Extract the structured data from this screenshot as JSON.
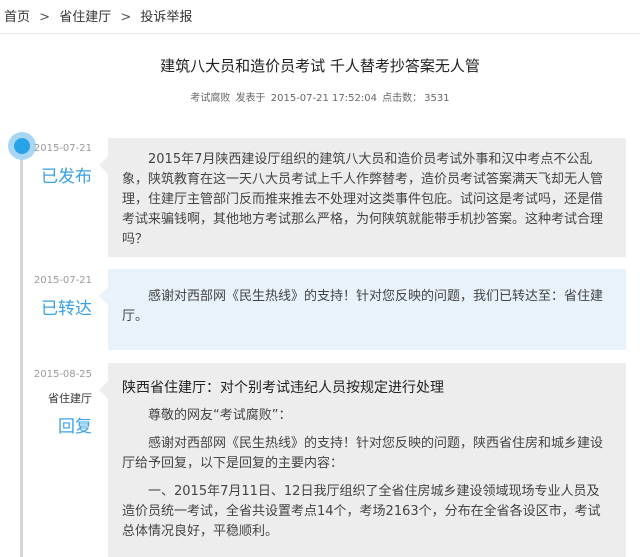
{
  "breadcrumb": {
    "home": "首页",
    "sep1": ">",
    "level2": "省住建厅",
    "sep2": ">",
    "level3": "投诉举报"
  },
  "article": {
    "title": "建筑八大员和造价员考试 千人替考抄答案无人管",
    "author": "考试腐败",
    "posted_label": "发表于",
    "posted_time": "2015-07-21 17:52:04",
    "clicks_label": "点击数：",
    "clicks": "3531"
  },
  "timeline": [
    {
      "date": "2015-07-21",
      "status": "已发布",
      "content": "2015年7月陕西建设厅组织的建筑八大员和造价员考试外事和汉中考点不公乱象，陕筑教育在这一天八大员考试上千人作弊替考，造价员考试答案满天飞却无人管理，住建厅主管部门反而推来推去不处理对这类事件包庇。试问这是考试吗，还是借考试来骗钱啊，其他地方考试那么严格，为何陕筑就能带手机抄答案。这种考试合理吗？"
    },
    {
      "date": "2015-07-21",
      "status": "已转达",
      "content": "感谢对西部网《民生热线》的支持！针对您反映的问题，我们已转达至：省住建厅。"
    },
    {
      "date": "2015-08-25",
      "dept": "省住建厅",
      "status": "回复",
      "reply_title": "陕西省住建厅：对个别考试违纪人员按规定进行处理",
      "paragraphs": [
        "尊敬的网友“考试腐败”：",
        "感谢对西部网《民生热线》的支持！针对您反映的问题，陕西省住房和城乡建设厅给予回复，以下是回复的主要内容：",
        "一、2015年7月11日、12日我厅组织了全省住房城乡建设领域现场专业人员及造价员统一考试，全省共设置考点14个，考场2163个，分布在全省各设区市，考试总体情况良好，平稳顺利。"
      ]
    }
  ],
  "colors": {
    "accent": "#3aa0e6",
    "dot_inner": "#29a3e8",
    "dot_outer": "#a9d6f3",
    "bubble_gray": "#ededed",
    "bubble_blue": "#e7f2fb",
    "line": "#d6d6d6"
  }
}
